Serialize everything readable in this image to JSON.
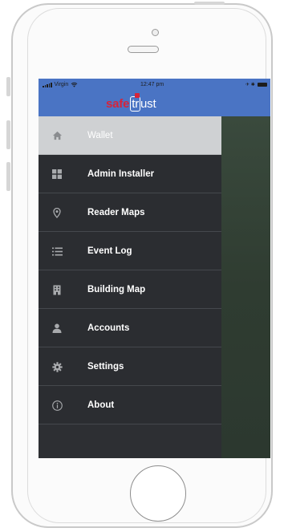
{
  "status_bar": {
    "carrier": "Virgin",
    "time": "12:47 pm",
    "right_indicators": "✈ ✱"
  },
  "header": {
    "logo_part1": "safe",
    "logo_part2": "tr",
    "logo_part3": "ust",
    "background_color": "#4a74c4",
    "logo_accent_color": "#d6243a"
  },
  "menu": {
    "items": [
      {
        "label": "Wallet",
        "icon": "home-icon",
        "active": true
      },
      {
        "label": "Admin Installer",
        "icon": "grid-icon",
        "active": false
      },
      {
        "label": "Reader Maps",
        "icon": "map-pin-icon",
        "active": false
      },
      {
        "label": "Event Log",
        "icon": "list-icon",
        "active": false
      },
      {
        "label": "Building Map",
        "icon": "building-icon",
        "active": false
      },
      {
        "label": "Accounts",
        "icon": "user-icon",
        "active": false
      },
      {
        "label": "Settings",
        "icon": "gear-icon",
        "active": false
      },
      {
        "label": "About",
        "icon": "info-icon",
        "active": false
      }
    ]
  },
  "colors": {
    "menu_background": "#2b2d31",
    "active_item_background": "#cfd1d3",
    "divider": "#45484d"
  }
}
